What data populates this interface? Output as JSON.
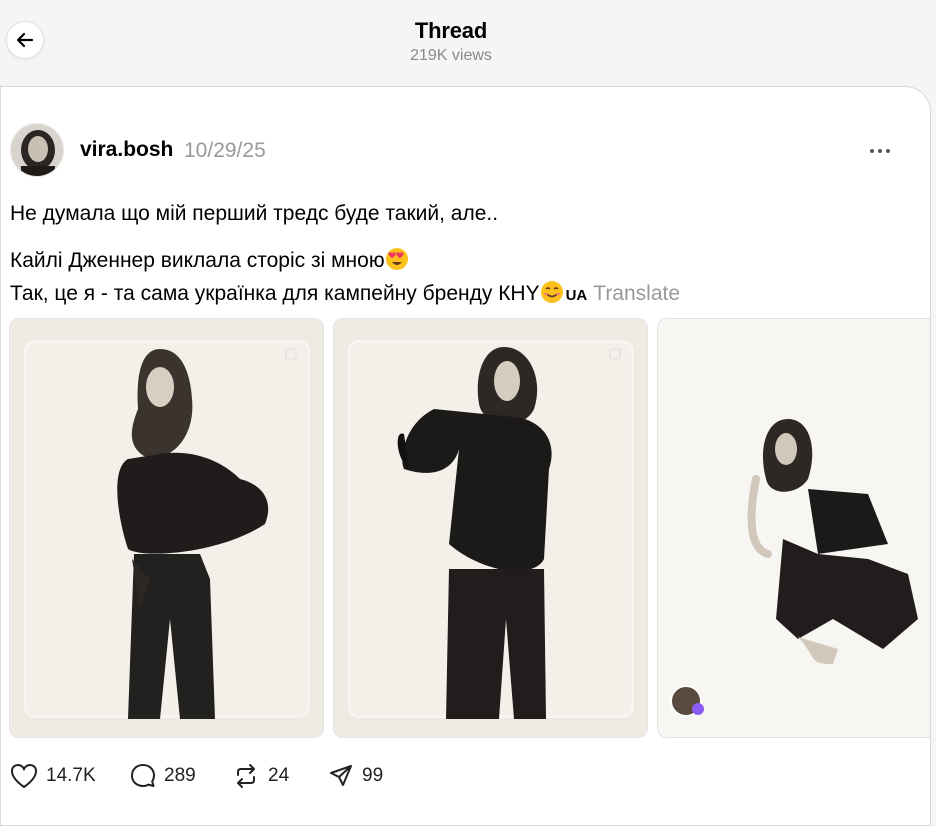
{
  "header": {
    "title": "Thread",
    "views": "219K views"
  },
  "post": {
    "username": "vira.bosh",
    "date": "10/29/25",
    "line1": "Не думала що мій перший тредс буде такий, але..",
    "line2": "Кайлі Дженнер виклала сторіс зі мною",
    "line3": "Так, це я - та сама українка для кампейну бренду КНY",
    "ua_tag": "UA",
    "translate": "Translate"
  },
  "actions": {
    "likes": "14.7K",
    "comments": "289",
    "reposts": "24",
    "shares": "99"
  },
  "icons": [
    "back-arrow-icon",
    "more-options-icon",
    "heart-icon",
    "comment-icon",
    "repost-icon",
    "share-icon",
    "heart-eyes-emoji",
    "winking-face-emoji"
  ]
}
